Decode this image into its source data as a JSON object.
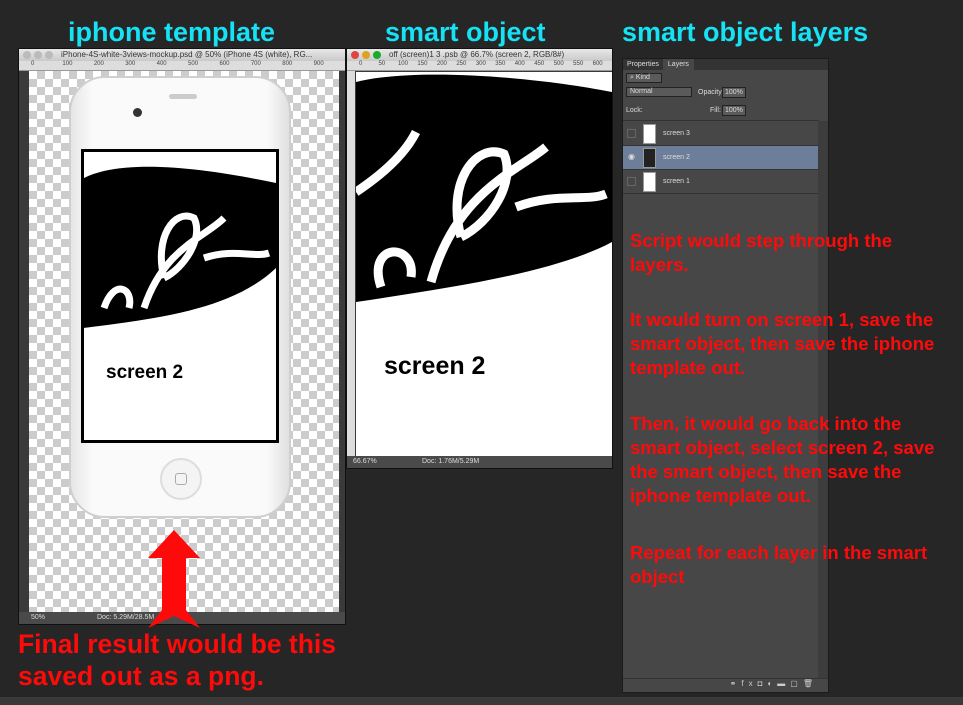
{
  "headings": {
    "left": "iphone template",
    "middle": "smart object",
    "right": "smart object layers"
  },
  "left_window": {
    "title": "iPhone-4S-white-3views-mockup.psd @ 50% (iPhone 4S (white), RG...",
    "ruler": [
      "0",
      "100",
      "200",
      "300",
      "400",
      "500",
      "600",
      "700",
      "800",
      "900"
    ],
    "zoom": "50%",
    "doc": "Doc: 5.29M/28.5M",
    "screen_label": "screen 2"
  },
  "middle_window": {
    "title": "off (screen)1 3 .psb @ 66.7% (screen 2, RGB/8#)",
    "ruler": [
      "0",
      "50",
      "100",
      "150",
      "200",
      "250",
      "300",
      "350",
      "400",
      "450",
      "500",
      "550",
      "600"
    ],
    "zoom": "66.67%",
    "doc": "Doc: 1.76M/5.29M",
    "screen_label": "screen 2"
  },
  "layers_panel": {
    "tabs": [
      "Properties",
      "Layers"
    ],
    "active_tab": "Layers",
    "filter": "Kind",
    "blend_mode": "Normal",
    "opacity_label": "Opacity:",
    "opacity": "100%",
    "lock_label": "Lock:",
    "fill_label": "Fill:",
    "fill": "100%",
    "layers": [
      {
        "name": "screen 3",
        "visible": false,
        "selected": false
      },
      {
        "name": "screen 2",
        "visible": true,
        "selected": true
      },
      {
        "name": "screen 1",
        "visible": false,
        "selected": false
      }
    ],
    "footer_icons": [
      "link-icon",
      "fx-icon",
      "mask-icon",
      "adjustment-icon",
      "folder-icon",
      "new-layer-icon",
      "trash-icon"
    ]
  },
  "annotations": {
    "p1": "Script would step through the layers.",
    "p2": "It would turn on screen 1, save the smart object, then save the iphone template out.",
    "p3": "Then, it would go back into the smart object, select screen 2, save the smart object, then save the iphone template out.",
    "p4": "Repeat for each layer in the smart object",
    "bottom": "Final result would be this saved out as a png."
  },
  "colors": {
    "heading": "#16e1f5",
    "annotation": "#ff0a0a",
    "selected_layer": "#6c7e99"
  }
}
